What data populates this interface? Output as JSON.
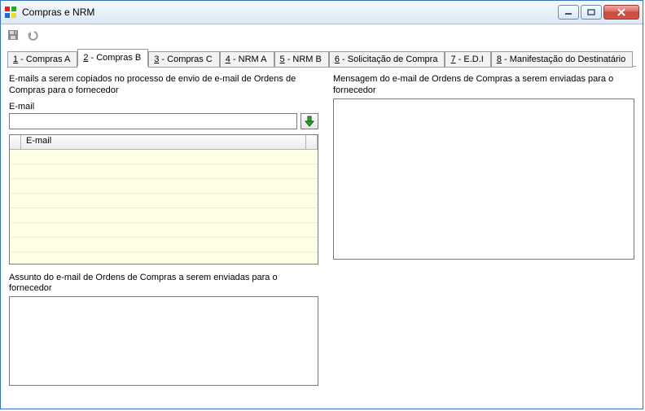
{
  "window": {
    "title": "Compras e NRM"
  },
  "tabs": [
    {
      "num": "1",
      "label": " - Compras A"
    },
    {
      "num": "2",
      "label": " - Compras B"
    },
    {
      "num": "3",
      "label": " - Compras C"
    },
    {
      "num": "4",
      "label": " - NRM A"
    },
    {
      "num": "5",
      "label": " - NRM B"
    },
    {
      "num": "6",
      "label": " - Solicitação de Compra"
    },
    {
      "num": "7",
      "label": " - E.D.I"
    },
    {
      "num": "8",
      "label": " - Manifestação do Destinatário"
    }
  ],
  "active_tab_index": 1,
  "left": {
    "section_label": "E-mails a serem copiados no processo de envio de e-mail de Ordens de Compras para o fornecedor",
    "email_field_label": "E-mail",
    "email_value": "",
    "grid_header": "E-mail",
    "subject_label": "Assunto do e-mail de Ordens de Compras a serem enviadas para o fornecedor",
    "subject_value": ""
  },
  "right": {
    "message_label": "Mensagem do e-mail de Ordens de Compras a serem enviadas para o fornecedor",
    "message_value": ""
  }
}
